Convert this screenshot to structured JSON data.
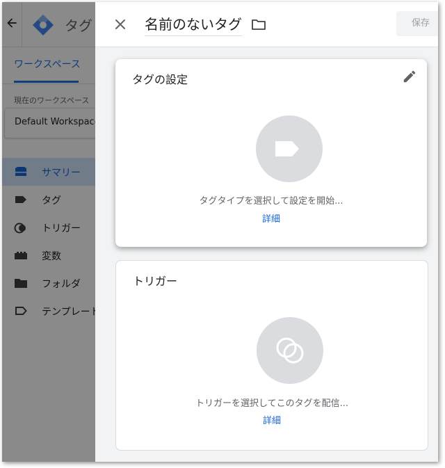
{
  "app": {
    "title": "タグ"
  },
  "left": {
    "tab_workspace": "ワークスペース",
    "current_ws_label": "現在のワークスペース",
    "current_ws_value": "Default Workspace",
    "nav": [
      {
        "label": "サマリー",
        "icon": "summary-icon",
        "active": true
      },
      {
        "label": "タグ",
        "icon": "tag-icon",
        "active": false
      },
      {
        "label": "トリガー",
        "icon": "trigger-icon",
        "active": false
      },
      {
        "label": "変数",
        "icon": "variables-icon",
        "active": false
      },
      {
        "label": "フォルダ",
        "icon": "folder-icon",
        "active": false
      },
      {
        "label": "テンプレート",
        "icon": "template-icon",
        "active": false
      }
    ]
  },
  "panel": {
    "tag_name": "名前のないタグ",
    "save_label": "保存",
    "tag_config": {
      "title": "タグの設定",
      "hint": "タグタイプを選択して設定を開始...",
      "learn_more": "詳細"
    },
    "triggering": {
      "title": "トリガー",
      "hint": "トリガーを選択してこのタグを配信...",
      "learn_more": "詳細"
    }
  },
  "colors": {
    "accent": "#1a73e8",
    "active_bg": "#d2e3fc",
    "placeholder_circle": "#dadce0"
  }
}
